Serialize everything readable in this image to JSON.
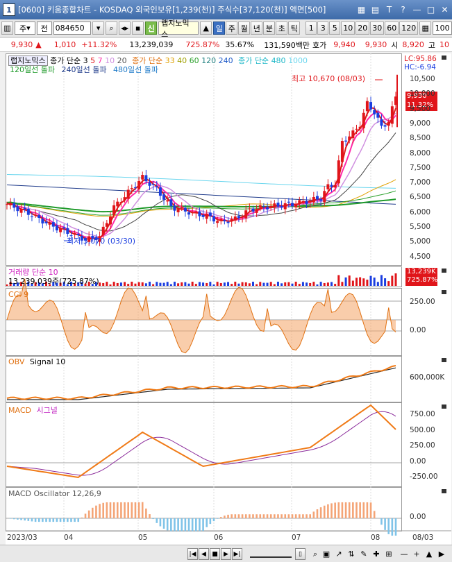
{
  "window": {
    "title": "[0600] 키움종합차트 - KOSDAQ 외국인보유[1,239(천)] 주식수[37,120(천)] 액면[500]",
    "app_icon": "1",
    "buttons": [
      "calculator-icon",
      "grid-icon",
      "help-icon",
      "question-icon",
      "minimize-icon",
      "maximize-icon",
      "close-icon"
    ]
  },
  "toolbar": {
    "period_label": "주",
    "prev_label": "전",
    "code": "084650",
    "badge": "신",
    "stock_name": "랩지노믹스",
    "tabs": [
      "일",
      "주",
      "월",
      "년",
      "분",
      "초",
      "틱"
    ],
    "active_tab": "일",
    "intervals": [
      "1",
      "3",
      "5",
      "10",
      "20",
      "30",
      "60",
      "120"
    ],
    "count": "100"
  },
  "info": {
    "price": "9,930",
    "change": "1,010",
    "change_pct": "+11.32%",
    "volume": "13,239,039",
    "volume_ratio": "725.87%",
    "turnover": "35.67%",
    "trade_value": "131,590백만",
    "ask_label": "호가",
    "ask": "9,940",
    "bid": "9,930",
    "open_label": "시",
    "open": "8,920",
    "high_label": "고",
    "high": "10"
  },
  "price_panel": {
    "header": {
      "name": "랩지노믹스",
      "ma1_label": "종가 단순",
      "ma1_periods": [
        "3",
        "5",
        "7",
        "10",
        "20"
      ],
      "ma2_label": "종가 단순",
      "ma2_periods": [
        "33",
        "40",
        "60",
        "120",
        "240"
      ],
      "ma3_label": "종가 단순",
      "ma3_periods": [
        "480",
        "1000"
      ],
      "line2": [
        "120일선 돌파",
        "240일선 돌파",
        "480일선 돌파"
      ]
    },
    "lc": "LC:95.86",
    "hc": "HC:-6.94",
    "max_label": "최고 10,670 (08/03)",
    "min_label": "최저 5,070 (03/30)",
    "last_price": "9,930",
    "last_pct": "11.32%",
    "y_ticks": [
      "10,500",
      "10,000",
      "9,500",
      "9,000",
      "8,500",
      "8,000",
      "7,500",
      "7,000",
      "6,500",
      "6,000",
      "5,500",
      "5,000",
      "4,500"
    ]
  },
  "volume_panel": {
    "label": "거래량 단순 10",
    "value": "13,239,039주(725.87%)",
    "badge_value": "13,239K",
    "badge_pct": "725.87%"
  },
  "cci_panel": {
    "label": "CCI 9",
    "y_ticks": [
      "250.00",
      "0.00"
    ]
  },
  "obv_panel": {
    "label": "OBV",
    "signal": "Signal 10",
    "y_ticks": [
      "600,000K"
    ]
  },
  "macd_panel": {
    "label": "MACD",
    "signal": "시그널",
    "y_ticks": [
      "750.00",
      "500.00",
      "250.00",
      "0.00",
      "-250.00"
    ]
  },
  "osc_panel": {
    "label": "MACD Oscillator 12,26,9",
    "y_ticks": [
      "0.00"
    ]
  },
  "x_axis": {
    "labels": [
      "2023/03",
      "04",
      "05",
      "06",
      "07",
      "08"
    ],
    "right_label": "08/03"
  },
  "colors": {
    "up": "#e0151a",
    "down": "#1b3ee0",
    "cci_fill_up": "#f4a466",
    "cci_fill_down": "#7fc3e8",
    "ma_pink": "#ff2aa8",
    "ma_green": "#1e9a2a",
    "ma_lightblue": "#6ad6ee",
    "obv": "#f07a16",
    "macd": "#f07a16",
    "signal": "#8a2a9a"
  }
}
